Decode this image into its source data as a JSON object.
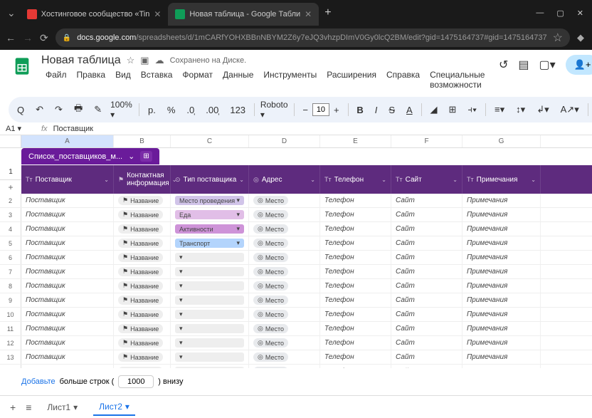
{
  "browser": {
    "tabs": [
      {
        "title": "Хостинговое сообщество «Tin",
        "favicon": "#e53935"
      },
      {
        "title": "Новая таблица - Google Табли",
        "favicon": "#0f9d58",
        "active": true
      }
    ],
    "url_host": "docs.google.com",
    "url_path": "/spreadsheets/d/1mCARfYOHXBBnNBYM2Z6y7eJQ3vhzpDImV0Gy0lcQ2BM/edit?gid=1475164737#gid=1475164737"
  },
  "doc": {
    "title": "Новая таблица",
    "saved": "Сохранено на Диске.",
    "menus": [
      "Файл",
      "Правка",
      "Вид",
      "Вставка",
      "Формат",
      "Данные",
      "Инструменты",
      "Расширения",
      "Справка",
      "Специальные возможности"
    ]
  },
  "toolbar": {
    "zoom": "100%",
    "font": "Roboto",
    "size": "10",
    "currency": "р."
  },
  "namebox": {
    "ref": "A1",
    "value": "Поставщик"
  },
  "columns": [
    "A",
    "B",
    "C",
    "D",
    "E",
    "F",
    "G"
  ],
  "tablechip": "Список_поставщиков_м...",
  "headers": [
    {
      "icon": "Tт",
      "label": "Поставщик"
    },
    {
      "icon": "⚑",
      "label": "Контактная информация"
    },
    {
      "icon": "⊙",
      "label": "Тип поставщика"
    },
    {
      "icon": "◎",
      "label": "Адрес"
    },
    {
      "icon": "Tт",
      "label": "Телефон"
    },
    {
      "icon": "Tт",
      "label": "Сайт"
    },
    {
      "icon": "Tт",
      "label": "Примечания"
    }
  ],
  "types": [
    "Место проведения",
    "Еда",
    "Активности",
    "Транспорт"
  ],
  "placeholders": {
    "supplier": "Поставщик",
    "name": "Название",
    "place": "Место",
    "phone": "Телефон",
    "site": "Сайт",
    "notes": "Примечания"
  },
  "addrows": {
    "link": "Добавьте",
    "more": "больше строк (",
    "count": "1000",
    "after": ") внизу"
  },
  "sheets": [
    "Лист1",
    "Лист2"
  ]
}
